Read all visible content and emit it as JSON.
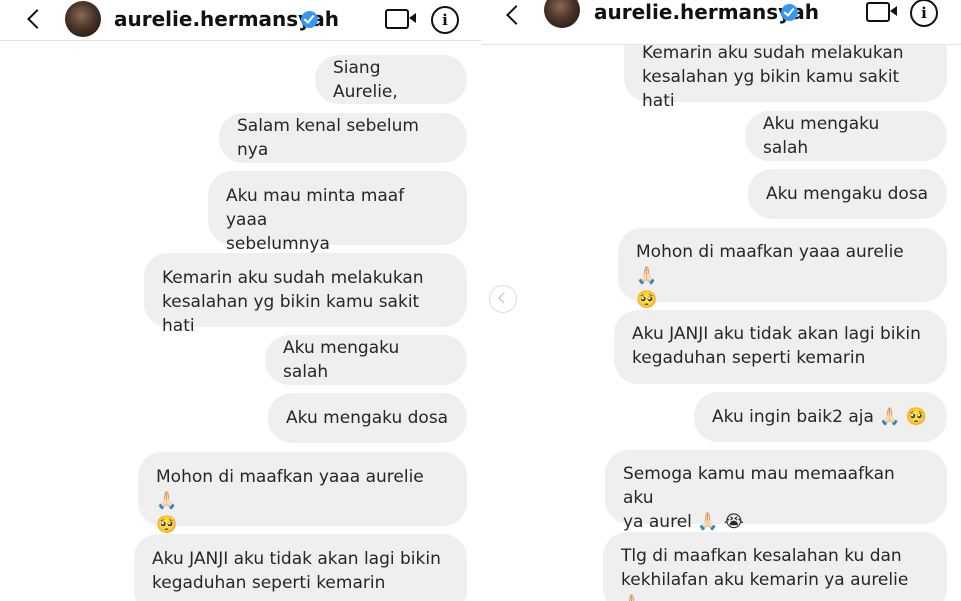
{
  "left": {
    "header": {
      "username": "aurelie.hermansyah"
    },
    "messages": [
      "Siang Aurelie,",
      "Salam kenal sebelum nya",
      "Aku mau minta maaf yaaa\nsebelumnya",
      "Kemarin aku sudah melakukan\nkesalahan yg bikin kamu sakit hati",
      "Aku mengaku salah",
      "Aku mengaku dosa",
      "Mohon di maafkan yaaa aurelie 🙏🏻\n🥺",
      "Aku JANJI aku tidak akan lagi bikin\nkegaduhan seperti kemarin"
    ]
  },
  "right": {
    "header": {
      "username": "aurelie.hermansyah"
    },
    "messages": [
      "Kemarin aku sudah melakukan\nkesalahan yg bikin kamu sakit hati",
      "Aku mengaku salah",
      "Aku mengaku dosa",
      "Mohon di maafkan yaaa aurelie 🙏🏻\n🥺",
      "Aku JANJI aku tidak akan lagi bikin\nkegaduhan seperti kemarin",
      "Aku ingin baik2 aja 🙏🏻 🥺",
      "Semoga kamu mau memaafkan aku\nya aurel 🙏🏻 😭",
      "Tlg di maafkan kesalahan ku dan\nkekhilafan aku kemarin ya aurelie 🙏🏻"
    ]
  },
  "icons": {
    "back": "chevron-left-icon",
    "verified": "verified-badge-icon",
    "video": "video-call-icon",
    "info": "info-icon",
    "nav": "carousel-prev-icon"
  },
  "colors": {
    "bubble_bg": "#efefef",
    "verified": "#3897f0",
    "text": "#262626"
  }
}
